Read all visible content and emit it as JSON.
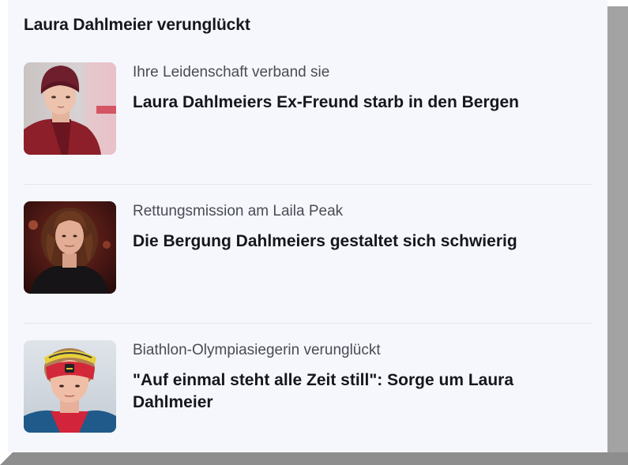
{
  "section": {
    "title": "Laura Dahlmeier verunglückt"
  },
  "articles": [
    {
      "kicker": "Ihre Leidenschaft verband sie",
      "title": "Laura Dahlmeiers Ex-Freund starb in den Bergen",
      "thumb_icon": "portrait-photo-beanie"
    },
    {
      "kicker": "Rettungsmission am Laila Peak",
      "title": "Die Bergung Dahlmeiers gestaltet sich schwierig",
      "thumb_icon": "portrait-photo-curly-hair"
    },
    {
      "kicker": "Biathlon-Olympiasiegerin verunglückt",
      "title": "\"Auf einmal steht alle Zeit still\": Sorge um Laura Dahlmeier",
      "thumb_icon": "portrait-photo-headband"
    }
  ],
  "colors": {
    "card_background": "#f6f7fc",
    "title_text": "#15171c",
    "kicker_text": "#494c56",
    "divider": "#e3e5ed"
  }
}
